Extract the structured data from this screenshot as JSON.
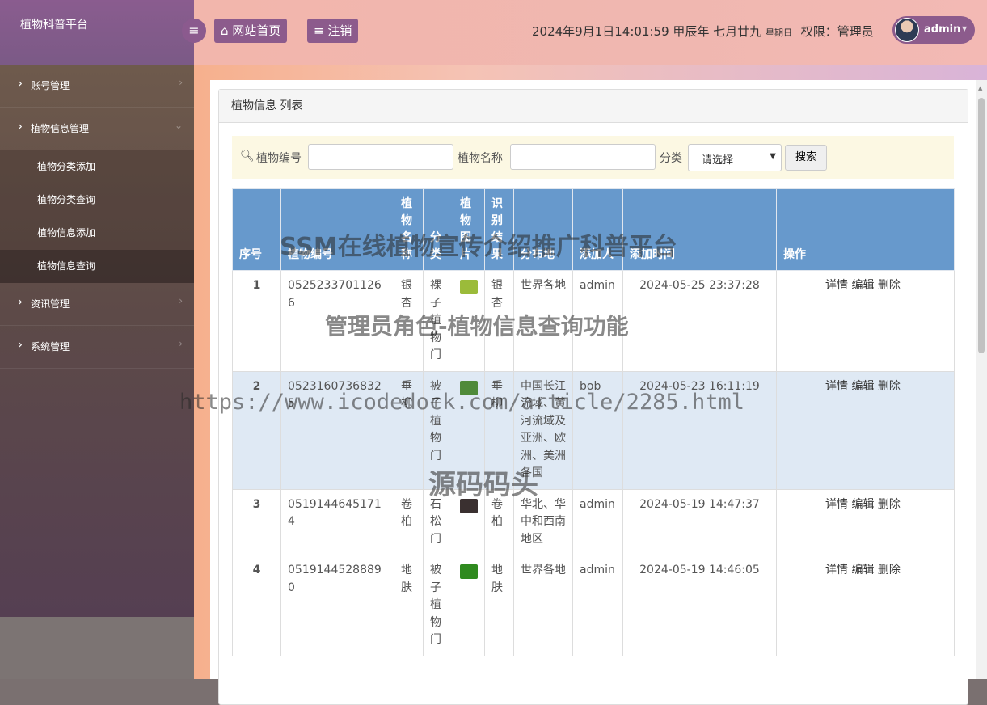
{
  "app": {
    "brand": "植物科普平台"
  },
  "sidebar": {
    "groups": [
      {
        "label": "账号管理",
        "expanded": false
      },
      {
        "label": "植物信息管理",
        "expanded": true,
        "items": [
          "植物分类添加",
          "植物分类查询",
          "植物信息添加",
          "植物信息查询"
        ],
        "active": "植物信息查询"
      },
      {
        "label": "资讯管理",
        "expanded": false
      },
      {
        "label": "系统管理",
        "expanded": false
      }
    ]
  },
  "header": {
    "home_label": "网站首页",
    "logout_label": "注销",
    "datetime": "2024年9月1日14:01:59 甲辰年 七月廿九",
    "weekday": "星期日",
    "role_label": "权限：管理员",
    "user": "admin"
  },
  "panel": {
    "title": "植物信息 列表"
  },
  "search": {
    "code_label": "植物编号",
    "name_label": "植物名称",
    "category_label": "分类",
    "category_selected": "请选择",
    "button_label": "搜索"
  },
  "table": {
    "headers": [
      "序号",
      "植物编号",
      "植物名称",
      "分类",
      "植物图片",
      "识别结果",
      "分布地",
      "添加人",
      "添加时间",
      "操作"
    ],
    "rows": [
      {
        "idx": "1",
        "code": "05252337011266",
        "name": "银杏",
        "category": "裸子植物门",
        "result": "银杏",
        "region": "世界各地",
        "adder": "admin",
        "time": "2024-05-25 23:37:28",
        "thumb_color": "#9bbb3a"
      },
      {
        "idx": "2",
        "code": "05231607368325",
        "name": "垂柳",
        "category": "被子植物门",
        "result": "垂柳",
        "region": "中国长江流域、黄河流域及亚洲、欧洲、美洲各国",
        "adder": "bob",
        "time": "2024-05-23 16:11:19",
        "thumb_color": "#4f8a3a"
      },
      {
        "idx": "3",
        "code": "05191446451714",
        "name": "卷柏",
        "category": "石松门",
        "result": "卷柏",
        "region": "华北、华中和西南地区",
        "adder": "admin",
        "time": "2024-05-19 14:47:37",
        "thumb_color": "#3a3030"
      },
      {
        "idx": "4",
        "code": "05191445288890",
        "name": "地肤",
        "category": "被子植物门",
        "result": "地肤",
        "region": "世界各地",
        "adder": "admin",
        "time": "2024-05-19 14:46:05",
        "thumb_color": "#2f8a1f"
      }
    ],
    "actions": [
      "详情",
      "编辑",
      "删除"
    ]
  },
  "watermark": {
    "line1": "SSM在线植物宣传介绍推广科普平台",
    "line2": "管理员角色-植物信息查询功能",
    "line3": "https://www.icodedock.com/article/2285.html",
    "line4": "源码码头"
  }
}
